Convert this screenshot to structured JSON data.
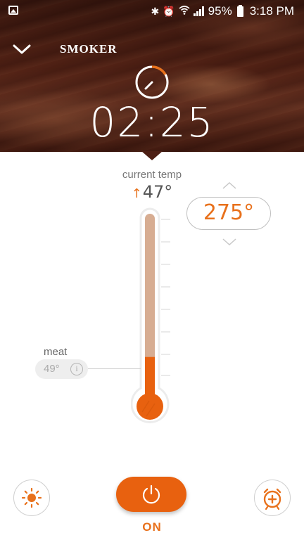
{
  "status_bar": {
    "battery": "95%",
    "time": "3:18 PM"
  },
  "header": {
    "title": "SMOKER",
    "timer": "02:25"
  },
  "current_temp": {
    "label": "current temp",
    "value": "47°",
    "trend": "↑"
  },
  "setpoint": {
    "value": "275°"
  },
  "meat_probe": {
    "label": "meat",
    "value": "49°",
    "info": "i"
  },
  "thermometer": {
    "fill_fraction": 0.24
  },
  "controls": {
    "power_label": "ON"
  },
  "colors": {
    "accent": "#e8711c",
    "power": "#e8610f",
    "tube": "#d7ad92"
  }
}
